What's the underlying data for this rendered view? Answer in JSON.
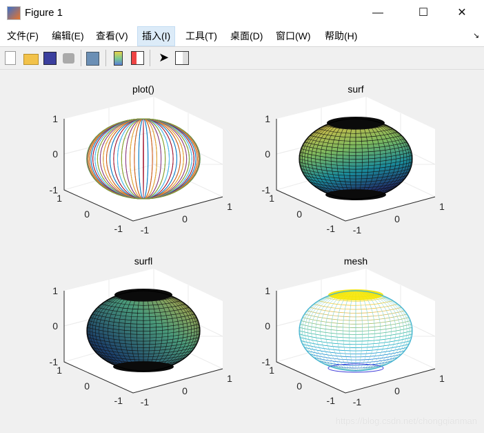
{
  "window": {
    "title": "Figure 1",
    "minimize": "—",
    "maximize": "☐",
    "close": "✕"
  },
  "menu": [
    {
      "label": "文件(F)"
    },
    {
      "label": "编辑(E)"
    },
    {
      "label": "查看(V)"
    },
    {
      "label": "插入(I)"
    },
    {
      "label": "工具(T)"
    },
    {
      "label": "桌面(D)"
    },
    {
      "label": "窗口(W)"
    },
    {
      "label": "帮助(H)"
    }
  ],
  "menu_corner_icon": "↘",
  "toolbar": [
    "new-figure-icon",
    "open-icon",
    "save-icon",
    "print-icon",
    "link-icon",
    "colorbar-icon",
    "legend-icon",
    "pointer-icon",
    "property-inspector-icon"
  ],
  "watermark": "https://blog.csdn.net/chongqianman",
  "chart_data": [
    {
      "type": "3d-line",
      "title": "plot()",
      "zticks": [
        "1",
        "0",
        "-1"
      ],
      "yticks": [
        "1",
        "0",
        "-1"
      ],
      "xticks": [
        "-1",
        "0",
        "1"
      ],
      "shape": "unit sphere",
      "xlim": [
        -1,
        1
      ],
      "ylim": [
        -1,
        1
      ],
      "zlim": [
        -1,
        1
      ],
      "style": "multicolor lines"
    },
    {
      "type": "3d-surface",
      "title": "surf",
      "zticks": [
        "1",
        "0",
        "-1"
      ],
      "yticks": [
        "1",
        "0",
        "-1"
      ],
      "xticks": [
        "-1",
        "0",
        "1"
      ],
      "shape": "unit sphere",
      "xlim": [
        -1,
        1
      ],
      "ylim": [
        -1,
        1
      ],
      "zlim": [
        -1,
        1
      ],
      "style": "surf"
    },
    {
      "type": "3d-surface",
      "title": "surfl",
      "zticks": [
        "1",
        "0",
        "-1"
      ],
      "yticks": [
        "1",
        "0",
        "-1"
      ],
      "xticks": [
        "-1",
        "0",
        "1"
      ],
      "shape": "unit sphere",
      "xlim": [
        -1,
        1
      ],
      "ylim": [
        -1,
        1
      ],
      "zlim": [
        -1,
        1
      ],
      "style": "surfl"
    },
    {
      "type": "3d-mesh",
      "title": "mesh",
      "zticks": [
        "1",
        "0",
        "-1"
      ],
      "yticks": [
        "1",
        "0",
        "-1"
      ],
      "xticks": [
        "-1",
        "0",
        "1"
      ],
      "shape": "unit sphere",
      "xlim": [
        -1,
        1
      ],
      "ylim": [
        -1,
        1
      ],
      "zlim": [
        -1,
        1
      ],
      "style": "mesh"
    }
  ]
}
